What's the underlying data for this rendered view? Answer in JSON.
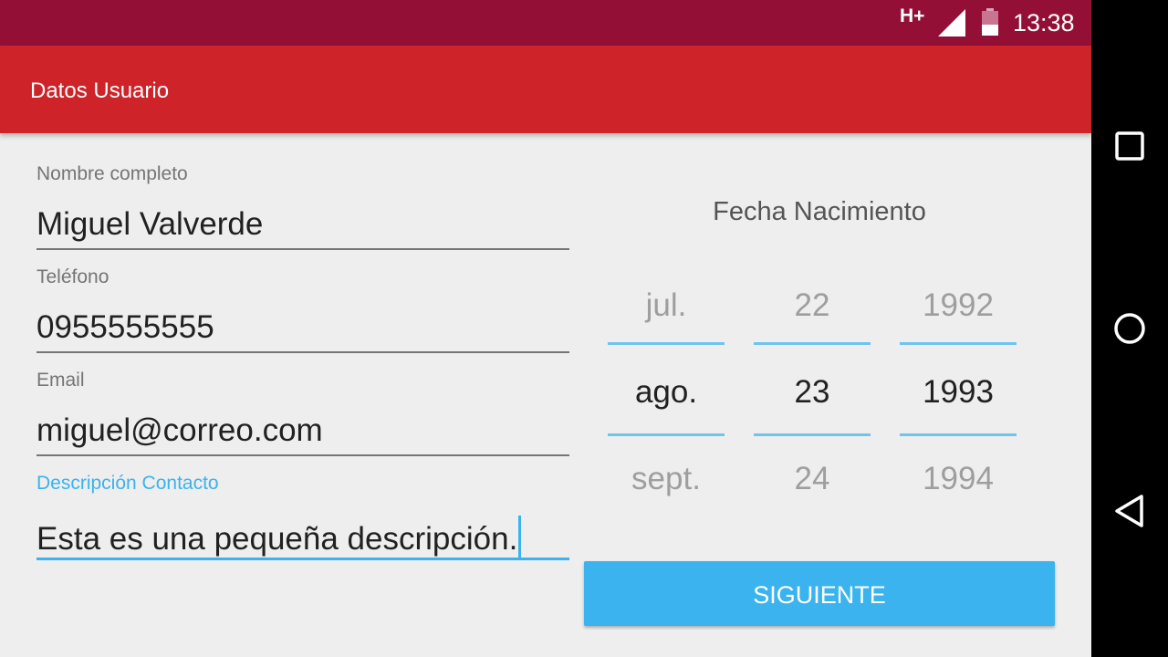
{
  "status_bar": {
    "network": "H+",
    "time": "13:38",
    "icons": [
      "signal-icon",
      "battery-icon"
    ]
  },
  "app_bar": {
    "title": "Datos Usuario",
    "color": "#cd2329"
  },
  "form": {
    "nombre": {
      "label": "Nombre completo",
      "value": "Miguel Valverde"
    },
    "telefono": {
      "label": "Teléfono",
      "value": "0955555555"
    },
    "email": {
      "label": "Email",
      "value": "miguel@correo.com"
    },
    "descripcion": {
      "label": "Descripción Contacto",
      "value": "Esta es una pequeña descripción."
    }
  },
  "date_picker": {
    "title": "Fecha Nacimiento",
    "month": {
      "prev": "jul.",
      "selected": "ago.",
      "next": "sept."
    },
    "day": {
      "prev": "22",
      "selected": "23",
      "next": "24"
    },
    "year": {
      "prev": "1992",
      "selected": "1993",
      "next": "1994"
    }
  },
  "actions": {
    "next_label": "SIGUIENTE",
    "accent": "#3ab3ee"
  },
  "nav_bar": {
    "buttons": [
      "recents-icon",
      "home-icon",
      "back-icon"
    ]
  }
}
